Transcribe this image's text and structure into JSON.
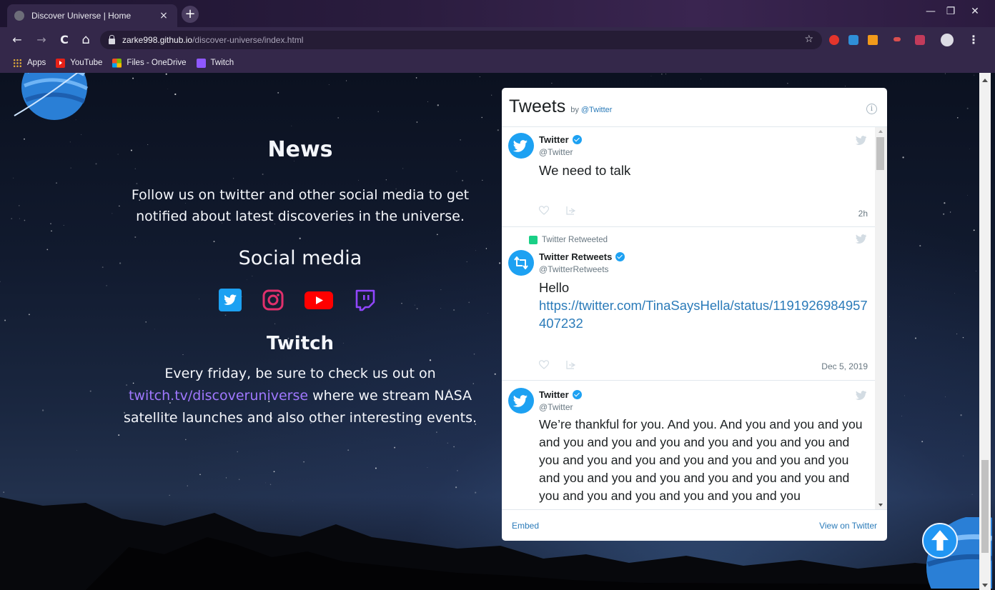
{
  "browser": {
    "tab_title": "Discover Universe | Home",
    "tab_close": "×",
    "new_tab": "+",
    "url_host": "zarke998.github.io",
    "url_path": "/discover-universe/index.html",
    "window_controls": {
      "minimize": "—",
      "restore": "❐",
      "close": "✕"
    },
    "nav": {
      "back": "←",
      "forward": "→",
      "reload": "C",
      "home": "⌂"
    },
    "bookmarks": [
      {
        "label": "Apps",
        "icon": "apps-grid-icon"
      },
      {
        "label": "YouTube",
        "icon": "youtube-icon"
      },
      {
        "label": "Files - OneDrive",
        "icon": "microsoft-icon"
      },
      {
        "label": "Twitch",
        "icon": "twitch-icon"
      }
    ]
  },
  "page": {
    "news_heading": "News",
    "news_text": "Follow us on twitter and other social media to get notified about latest discoveries in the universe.",
    "social_heading": "Social media",
    "social_icons": [
      "twitter-icon",
      "instagram-icon",
      "youtube-icon",
      "twitch-icon"
    ],
    "twitch_heading": "Twitch",
    "twitch_text_before": "Every friday, be sure to check us out on",
    "twitch_link": "twitch.tv/discoveruniverse",
    "twitch_text_after": "where we stream NASA satellite launches and also other interesting events."
  },
  "widget": {
    "title": "Tweets",
    "by_prefix": "by",
    "by_account": "@Twitter",
    "info": "i",
    "tweets": [
      {
        "name": "Twitter",
        "handle": "@Twitter",
        "text": "We need to talk",
        "date": "2h"
      },
      {
        "retweet_label": "Twitter Retweeted",
        "name": "Twitter Retweets",
        "handle": "@TwitterRetweets",
        "text": "Hello",
        "link": "https://twitter.com/TinaSaysHella/status/1191926984957407232",
        "date": "Dec 5, 2019"
      },
      {
        "name": "Twitter",
        "handle": "@Twitter",
        "text": "We’re thankful for you. And you. And you and you and you and you and you and you and you and you and you and you and you and you and you and you and you and you and you and you and you and you and you and you and you and you and you and you and you and you"
      }
    ],
    "footer_embed": "Embed",
    "footer_view": "View on Twitter"
  },
  "colors": {
    "twitter": "#1da1f2",
    "instagram": "#e1306c",
    "youtube": "#ff0000",
    "twitch": "#9146ff",
    "link": "#2b7bb9"
  }
}
